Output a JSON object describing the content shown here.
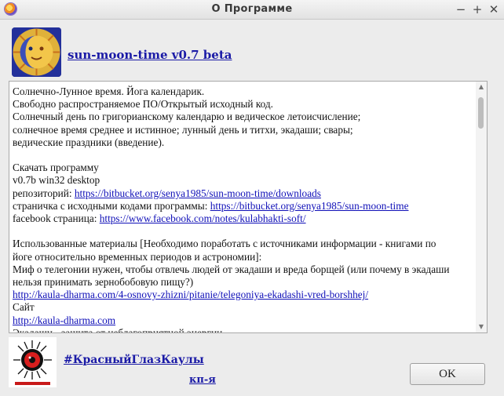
{
  "window": {
    "title": "О Программе",
    "controls": {
      "minimize": "−",
      "maximize": "+",
      "close": "✕"
    }
  },
  "header": {
    "app_name": "sun-moon-time v0.7 beta"
  },
  "content": {
    "desc1": "Солнечно-Лунное время. Йога календарик.",
    "desc2": "Свободно распространяемое ПО/Открытый исходный код.",
    "desc3": "Солнечный день по григорианскому календарю и ведическое летоисчисление;",
    "desc4": "солнечное время среднее и истинное; лунный день и титхи, экадаши; свары;",
    "desc5": "ведические праздники (введение).",
    "download_heading": "Скачать программу",
    "version_line": "v0.7b win32 desktop",
    "repo_label": "репозиторий: ",
    "repo_url": "https://bitbucket.org/senya1985/sun-moon-time/downloads",
    "source_label": "страничка с исходными кодами программы: ",
    "source_url": "https://bitbucket.org/senya1985/sun-moon-time",
    "facebook_label": "facebook страница: ",
    "facebook_url": "https://www.facebook.com/notes/kulabhakti-soft/",
    "materials1": "Использованные материалы [Необходимо поработать с источниками информации - книгами по",
    "materials2": "йоге относительно временных периодов и астрономии]:",
    "myth1": "Миф о телегонии нужен, чтобы отвлечь людей от экадаши и вреда борщей (или почему в экадаши",
    "myth2": "нельзя принимать зернобобовую пищу?)",
    "myth_url": "http://kaula-dharma.com/4-osnovy-zhizni/pitanie/telegoniya-ekadashi-vred-borshhej/",
    "site_label": "Сайт",
    "site_url": "http://kaula-dharma.com",
    "ekadashi_partial": "Экадаши - защита от неблагоприятной энергии"
  },
  "footer": {
    "hashtag_link": "#КрасныйГлазКаулы",
    "kp_link": "кп-я",
    "ok_button": "OK"
  },
  "colors": {
    "link": "#1010b8",
    "window_bg": "#ececec",
    "pane_bg": "#ffffff"
  }
}
